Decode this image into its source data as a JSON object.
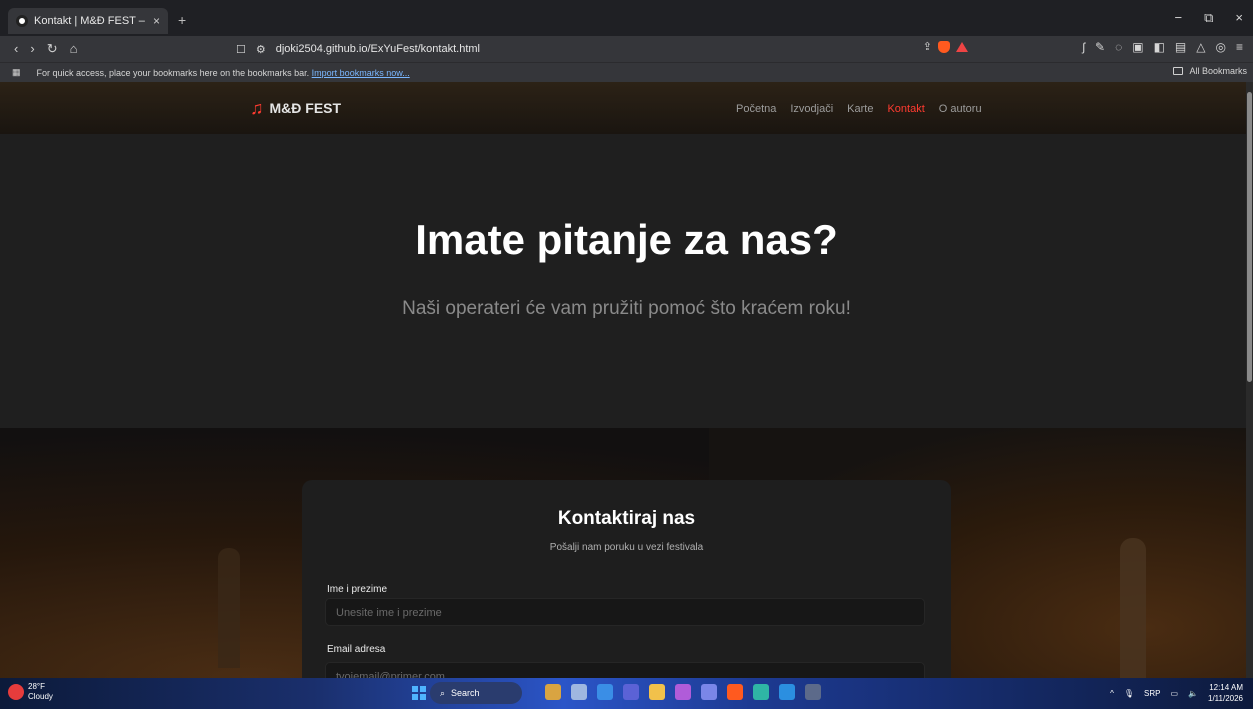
{
  "browser": {
    "tab_title": "Kontakt | M&Đ FEST – EX-YU M...",
    "tab_close": "×",
    "new_tab": "+",
    "win_min": "−",
    "win_max": "⧉",
    "win_close": "×",
    "url": "djoki2504.github.io/ExYuFest/kontakt.html",
    "bookmarks_bar_text": "For quick access, place your bookmarks here on the bookmarks bar.",
    "import_link": "Import bookmarks now...",
    "all_bookmarks": "All Bookmarks"
  },
  "site": {
    "brand": "M&Đ FEST",
    "nav": [
      "Početna",
      "Izvodjači",
      "Karte",
      "Kontakt",
      "O autoru"
    ],
    "active_nav": "Kontakt",
    "accent_color": "#ff3b30"
  },
  "hero": {
    "title": "Imate pitanje za nas?",
    "subtitle": "Naši operateri će vam pružiti pomoć što kraćem roku!"
  },
  "contact_card": {
    "title": "Kontaktiraj nas",
    "subtitle": "Pošalji nam poruku u vezi festivala",
    "name_label": "Ime i prezime",
    "name_placeholder": "Unesite ime i prezime",
    "email_label": "Email adresa",
    "email_placeholder": "tvojemail@primer.com"
  },
  "taskbar": {
    "temp": "28°F",
    "weather": "Cloudy",
    "search": "Search",
    "lang": "SRP",
    "time": "12:14 AM",
    "date": "1/11/2026"
  }
}
